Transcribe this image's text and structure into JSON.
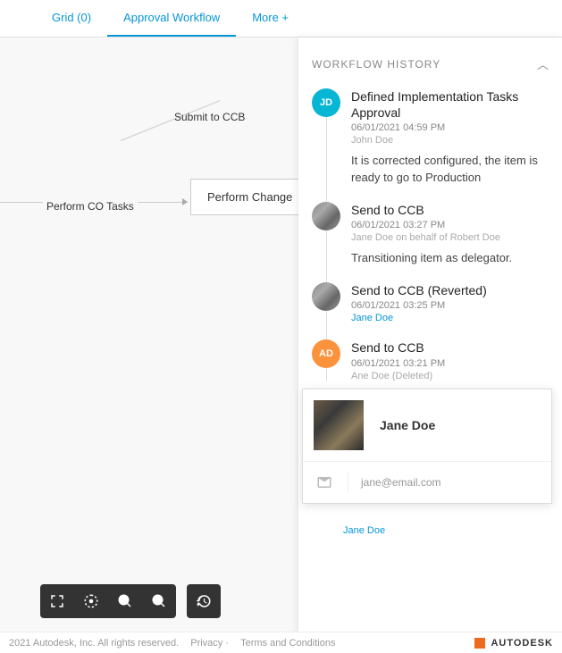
{
  "tabs": {
    "grid": "Grid (0)",
    "approval": "Approval Workflow",
    "more": "More +"
  },
  "canvas": {
    "submit": "Submit to CCB",
    "perform_co": "Perform CO Tasks",
    "perform_change": "Perform Change"
  },
  "history": {
    "title": "WORKFLOW HISTORY",
    "items": [
      {
        "avatar": "JD",
        "avatar_class": "jd",
        "title": "Defined Implementation Tasks Approval",
        "meta": "06/01/2021 04:59 PM",
        "user": "John Doe",
        "user_class": "faded",
        "comment": "It is corrected configured, the item is ready to go to Production"
      },
      {
        "avatar": "",
        "avatar_class": "img",
        "title": "Send to CCB",
        "meta": "06/01/2021 03:27 PM",
        "user": "Jane Doe on behalf of Robert Doe",
        "user_class": "faded",
        "comment": "Transitioning item as delegator."
      },
      {
        "avatar": "",
        "avatar_class": "img",
        "title": "Send to CCB (Reverted)",
        "meta": "06/01/2021 03:25 PM",
        "user": "Jane Doe",
        "user_class": "",
        "comment": ""
      },
      {
        "avatar": "AD",
        "avatar_class": "ad",
        "title": "Send to CCB",
        "meta": "06/01/2021 03:21 PM",
        "user": "Ane Doe (Deleted)",
        "user_class": "faded",
        "comment": ""
      }
    ],
    "trailing_user": "Jane Doe"
  },
  "popover": {
    "name": "Jane Doe",
    "email": "jane@email.com"
  },
  "footer": {
    "copyright": "2021 Autodesk, Inc. All rights reserved.",
    "privacy": "Privacy",
    "terms": "Terms and Conditions",
    "brand": "AUTODESK"
  }
}
